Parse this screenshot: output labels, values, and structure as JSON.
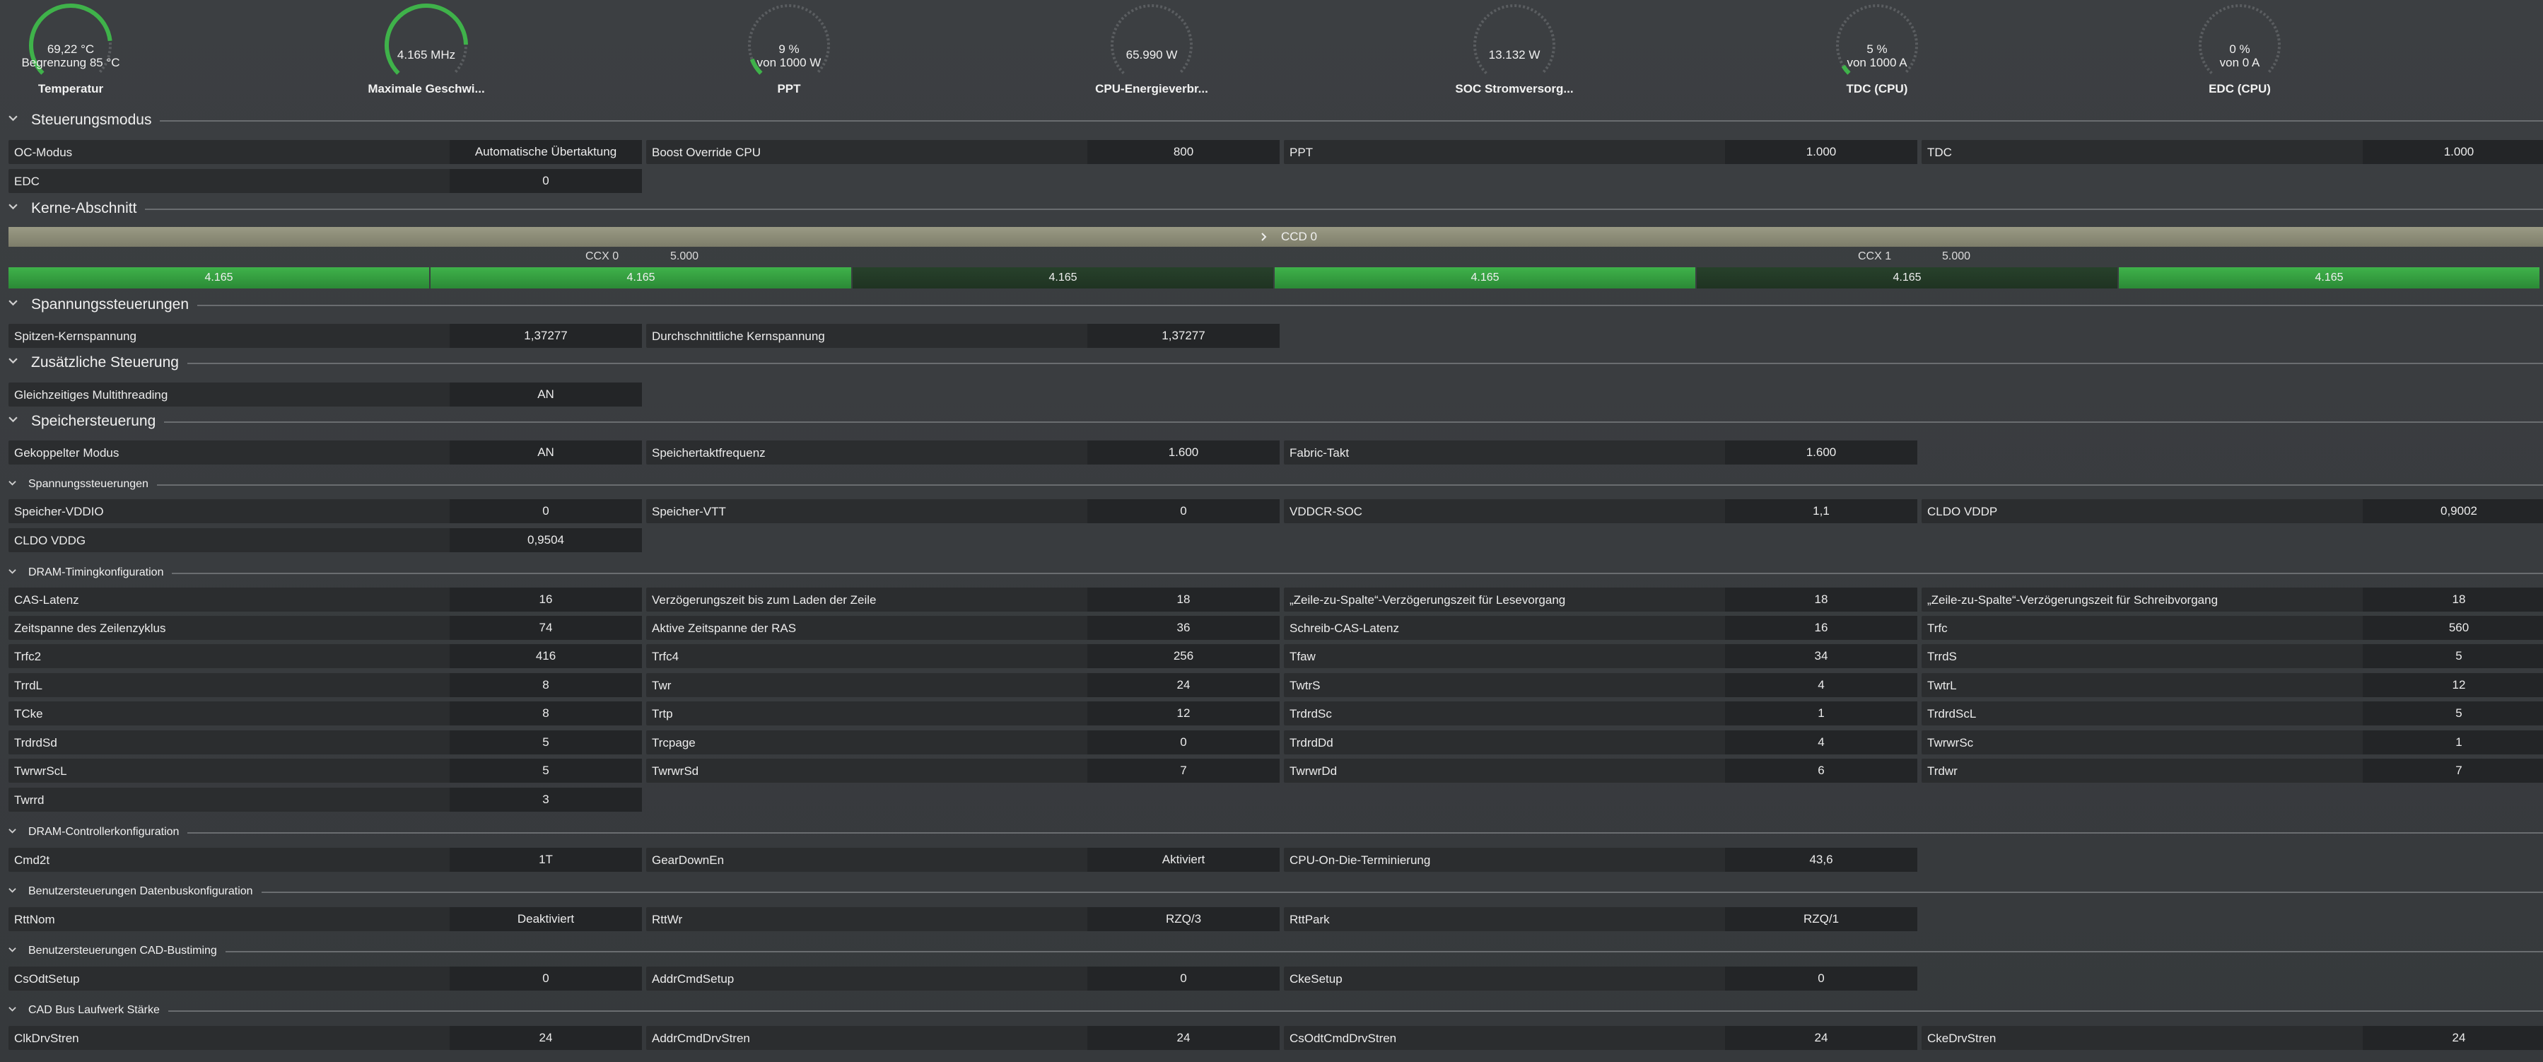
{
  "gauges": [
    {
      "value": "69,22 °C",
      "value2": "Begrenzung 85 °C",
      "label": "Temperatur",
      "level": 0.81
    },
    {
      "value": "4.165  MHz",
      "value2": "",
      "label": "Maximale Geschwi...",
      "level": 0.83
    },
    {
      "value": "9 %",
      "value2": "von 1000 W",
      "label": "PPT",
      "level": 0.09
    },
    {
      "value": "65.990 W",
      "value2": "",
      "label": "CPU-Energieverbr...",
      "level": 0.0
    },
    {
      "value": "13.132 W",
      "value2": "",
      "label": "SOC Stromversorg...",
      "level": 0.0
    },
    {
      "value": "5 %",
      "value2": "von 1000 A",
      "label": "TDC (CPU)",
      "level": 0.05
    },
    {
      "value": "0 %",
      "value2": "von 0 A",
      "label": "EDC (CPU)",
      "level": 0.0
    }
  ],
  "colors": {
    "accent": "#3fb24a",
    "bg": "#3a3d40",
    "cell": "#2b2d2f",
    "track": "#5a5d60",
    "ccd_bar": "#8c8c78"
  },
  "icons": {
    "section_toggle": "chevron-down-icon",
    "ccd_toggle": "chevron-right-icon"
  },
  "sections": {
    "steuerungsmodus": "Steuerungsmodus",
    "kerne": "Kerne-Abschnitt",
    "spannung": "Spannungssteuerungen",
    "zusatz": "Zusätzliche Steuerung",
    "speicher": "Speichersteuerung",
    "speicher_spannung": "Spannungssteuerungen",
    "dram_timing": "DRAM-Timingkonfiguration",
    "dram_ctrl": "DRAM-Controllerkonfiguration",
    "datenbus": "Benutzersteuerungen Datenbuskonfiguration",
    "cad_bustiming": "Benutzersteuerungen CAD-Bustiming",
    "cad_drive": "CAD Bus Laufwerk Stärke"
  },
  "rows": {
    "r1": [
      [
        "OC-Modus",
        "Automatische Übertaktung"
      ],
      [
        "Boost Override CPU",
        "800"
      ],
      [
        "PPT",
        "1.000"
      ],
      [
        "TDC",
        "1.000"
      ]
    ],
    "r2": [
      [
        "EDC",
        "0"
      ]
    ],
    "volt": [
      [
        "Spitzen-Kernspannung",
        "1,37277"
      ],
      [
        "Durchschnittliche Kernspannung",
        "1,37277"
      ]
    ],
    "smt": [
      [
        "Gleichzeitiges Multithreading",
        "AN"
      ]
    ],
    "mem": [
      [
        "Gekoppelter Modus",
        "AN"
      ],
      [
        "Speichertaktfrequenz",
        "1.600"
      ],
      [
        "Fabric-Takt",
        "1.600"
      ]
    ],
    "mv1": [
      [
        "Speicher-VDDIO",
        "0"
      ],
      [
        "Speicher-VTT",
        "0"
      ],
      [
        "VDDCR-SOC",
        "1,1"
      ],
      [
        "CLDO VDDP",
        "0,9002"
      ]
    ],
    "mv2": [
      [
        "CLDO VDDG",
        "0,9504"
      ]
    ],
    "t1": [
      [
        "CAS-Latenz",
        "16"
      ],
      [
        "Verzögerungszeit bis zum Laden der Zeile",
        "18"
      ],
      [
        "„Zeile-zu-Spalte“-Verzögerungszeit für Lesevorgang",
        "18"
      ],
      [
        "„Zeile-zu-Spalte“-Verzögerungszeit für Schreibvorgang",
        "18"
      ]
    ],
    "t2": [
      [
        "Zeitspanne des Zeilenzyklus",
        "74"
      ],
      [
        "Aktive Zeitspanne der RAS",
        "36"
      ],
      [
        "Schreib-CAS-Latenz",
        "16"
      ],
      [
        "Trfc",
        "560"
      ]
    ],
    "t3": [
      [
        "Trfc2",
        "416"
      ],
      [
        "Trfc4",
        "256"
      ],
      [
        "Tfaw",
        "34"
      ],
      [
        "TrrdS",
        "5"
      ]
    ],
    "t4": [
      [
        "TrrdL",
        "8"
      ],
      [
        "Twr",
        "24"
      ],
      [
        "TwtrS",
        "4"
      ],
      [
        "TwtrL",
        "12"
      ]
    ],
    "t5": [
      [
        "TCke",
        "8"
      ],
      [
        "Trtp",
        "12"
      ],
      [
        "TrdrdSc",
        "1"
      ],
      [
        "TrdrdScL",
        "5"
      ]
    ],
    "t6": [
      [
        "TrdrdSd",
        "5"
      ],
      [
        "Trcpage",
        "0"
      ],
      [
        "TrdrdDd",
        "4"
      ],
      [
        "TwrwrSc",
        "1"
      ]
    ],
    "t7": [
      [
        "TwrwrScL",
        "5"
      ],
      [
        "TwrwrSd",
        "7"
      ],
      [
        "TwrwrDd",
        "6"
      ],
      [
        "Trdwr",
        "7"
      ]
    ],
    "t8": [
      [
        "Twrrd",
        "3"
      ]
    ],
    "c1": [
      [
        "Cmd2t",
        "1T"
      ],
      [
        "GearDownEn",
        "Aktiviert"
      ],
      [
        "CPU-On-Die-Terminierung",
        "43,6"
      ]
    ],
    "d1": [
      [
        "RttNom",
        "Deaktiviert"
      ],
      [
        "RttWr",
        "RZQ/3"
      ],
      [
        "RttPark",
        "RZQ/1"
      ]
    ],
    "b1": [
      [
        "CsOdtSetup",
        "0"
      ],
      [
        "AddrCmdSetup",
        "0"
      ],
      [
        "CkeSetup",
        "0"
      ]
    ],
    "s1": [
      [
        "ClkDrvStren",
        "24"
      ],
      [
        "AddrCmdDrvStren",
        "24"
      ],
      [
        "CsOdtCmdDrvStren",
        "24"
      ],
      [
        "CkeDrvStren",
        "24"
      ]
    ]
  },
  "ccd": {
    "label": "CCD 0",
    "ccx0": "CCX 0",
    "ccx0_max": "5.000",
    "ccx1": "CCX 1",
    "ccx1_max": "5.000",
    "cores": [
      {
        "value": "4.165",
        "level": 1.0
      },
      {
        "value": "4.165",
        "level": 1.0
      },
      {
        "value": "4.165",
        "level": 0.0
      },
      {
        "value": "4.165",
        "level": 1.0
      },
      {
        "value": "4.165",
        "level": 0.0
      },
      {
        "value": "4.165",
        "level": 1.0
      }
    ]
  }
}
